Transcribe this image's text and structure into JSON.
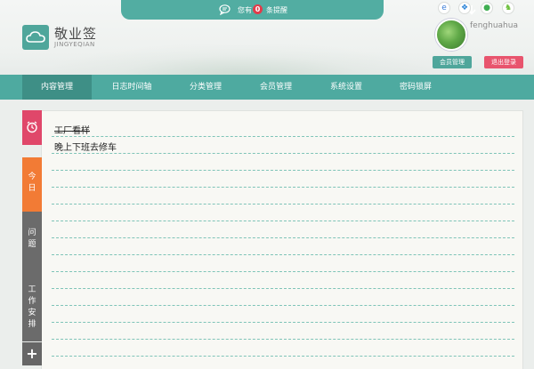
{
  "app": {
    "title": "敬业签",
    "subtitle": "JINGYEQIAN"
  },
  "notify": {
    "prefix": "您有",
    "count": "0",
    "suffix": "条提醒"
  },
  "user": {
    "name": "fenghuahua",
    "member_btn": "会员管理",
    "logout_btn": "退出登录"
  },
  "nav": {
    "items": [
      {
        "label": "内容管理"
      },
      {
        "label": "日志时间轴"
      },
      {
        "label": "分类管理"
      },
      {
        "label": "会员管理"
      },
      {
        "label": "系统设置"
      },
      {
        "label": "密码锁屏"
      }
    ]
  },
  "side": {
    "today": "今日",
    "issue": "问题",
    "work": "工作安排",
    "add": "+"
  },
  "notes": [
    {
      "text": "工厂看样",
      "done": true
    },
    {
      "text": "晚上下班去修车",
      "done": false
    }
  ],
  "colors": {
    "accent": "#4eaaa0",
    "alarm": "#e0476a",
    "today": "#f27b35",
    "gray_tab": "#6b6b6b",
    "logout": "#e8546d"
  },
  "icons": [
    "cloud-logo-icon",
    "message-icon",
    "arrow-down-icon",
    "ie-icon",
    "windows-icon",
    "apple-icon",
    "android-icon",
    "alarm-clock-icon",
    "plus-icon"
  ]
}
